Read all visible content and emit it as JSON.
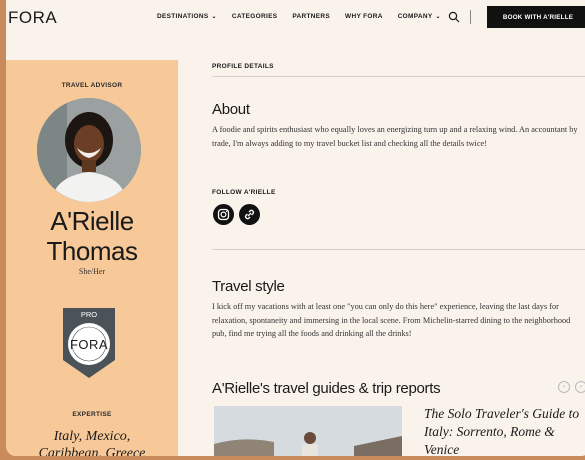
{
  "brand": {
    "logo_text": "FORA"
  },
  "nav": {
    "items": [
      {
        "label": "DESTINATIONS",
        "has_dropdown": true
      },
      {
        "label": "CATEGORIES",
        "has_dropdown": false
      },
      {
        "label": "PARTNERS",
        "has_dropdown": false
      },
      {
        "label": "WHY FORA",
        "has_dropdown": false
      },
      {
        "label": "COMPANY",
        "has_dropdown": true
      }
    ],
    "search_icon": "search-icon",
    "cta_label": "BOOK WITH A'RIELLE"
  },
  "profile": {
    "role_label": "TRAVEL ADVISOR",
    "first_name": "A'Rielle",
    "last_name": "Thomas",
    "pronouns": "She/Her",
    "badge": {
      "tier": "PRO",
      "brand": "FORA"
    },
    "expertise_label": "EXPERTISE",
    "expertise_line1": "Italy, Mexico,",
    "expertise_line2": "Caribbean, Greece"
  },
  "details": {
    "section_label": "PROFILE DETAILS",
    "about_title": "About",
    "about_text": "A foodie and spirits enthusiast who equally loves an energizing turn up and a relaxing wind. An accountant by trade, I'm always adding to my travel bucket list and checking all the details twice!",
    "follow_label": "FOLLOW A'RIELLE",
    "socials": [
      "instagram-icon",
      "link-icon"
    ],
    "travel_style_title": "Travel style",
    "travel_style_text": "I kick off my vacations with at least one \"you can only do this here\" experience, leaving the last days for relaxation, spontaneity and immersing in the local scene. From Michelin-starred dining to the neighborhood pub, find me trying all the foods and drinking all the drinks!",
    "guides_title": "A'Rielle's travel guides & trip reports",
    "guide_card_title": "The Solo Traveler's Guide to Italy: Sorrento, Rome & Venice"
  },
  "colors": {
    "background_outer": "#c98a5c",
    "page": "#faf3ec",
    "profile_card": "#f7c898",
    "cta": "#111111"
  }
}
